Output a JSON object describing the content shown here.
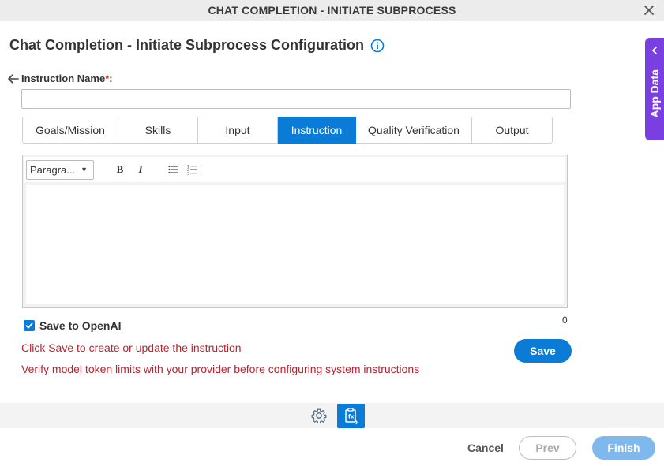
{
  "window": {
    "title": "CHAT COMPLETION - INITIATE SUBPROCESS",
    "close_icon": "close-icon"
  },
  "header": {
    "page_title": "Chat Completion - Initiate Subprocess Configuration",
    "info_icon": "info-icon"
  },
  "side_panel": {
    "label": "App Data",
    "icon": "chevron-left-icon",
    "color": "#7a3fe0"
  },
  "form": {
    "instruction_name_label": "Instruction Name",
    "required_mark": "*",
    "label_suffix": ":",
    "instruction_name_value": "",
    "instruction_name_placeholder": ""
  },
  "tabs": [
    {
      "label": "Goals/Mission",
      "active": false
    },
    {
      "label": "Skills",
      "active": false
    },
    {
      "label": "Input",
      "active": false
    },
    {
      "label": "Instruction",
      "active": true
    },
    {
      "label": "Quality Verification",
      "active": false
    },
    {
      "label": "Output",
      "active": false
    }
  ],
  "editor": {
    "paragraph_select": "Paragra...",
    "bold_label": "B",
    "italic_label": "I",
    "bullet_list_icon": "bullet-list-icon",
    "numbered_list_icon": "numbered-list-icon",
    "content": "",
    "char_count": "0"
  },
  "save_to_openai": {
    "label": "Save to OpenAI",
    "checked": true
  },
  "messages": {
    "save_hint": "Click Save to create or update the instruction",
    "token_hint": "Verify model token limits with your provider before configuring system instructions"
  },
  "buttons": {
    "save": "Save",
    "cancel": "Cancel",
    "prev": "Prev",
    "finish": "Finish"
  },
  "bottom_toolbar": {
    "gear_icon": "gear-icon",
    "document_icon": "document-icon"
  },
  "colors": {
    "accent": "#0a7bd7",
    "error_text": "#b8232e",
    "finish_disabled": "#7fb8ec"
  }
}
